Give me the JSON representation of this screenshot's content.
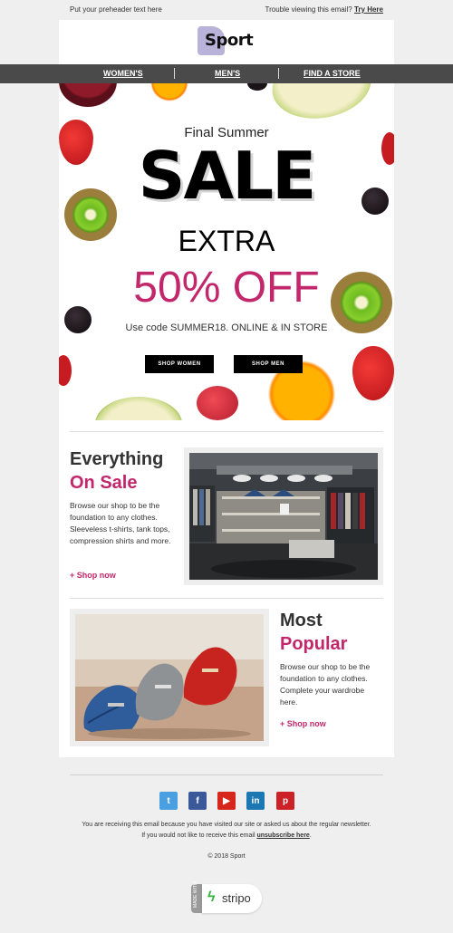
{
  "preheader": {
    "text": "Put your preheader text here",
    "trouble": "Trouble viewing this email?",
    "try_here": "Try Here"
  },
  "logo": {
    "text": "Sport"
  },
  "nav": {
    "items": [
      "WOMEN'S",
      "MEN'S",
      "FIND A STORE"
    ]
  },
  "hero": {
    "line1": "Final Summer",
    "line2": "SALE",
    "line3": "EXTRA",
    "line4": "50% OFF",
    "code": "Use code SUMMER18. ONLINE & IN STORE",
    "btn_women": "SHOP WOMEN",
    "btn_men": "SHOP MEN"
  },
  "section1": {
    "title_dark": "Everything",
    "title_pink": "On Sale",
    "body": "Browse our shop to be the foundation to any clothes. Sleeveless t-shirts, tank tops, compression shirts and more.",
    "link": "+ Shop now"
  },
  "section2": {
    "title_dark": "Most",
    "title_pink": "Popular",
    "body": "Browse our shop to be the foundation to any clothes. Complete your wardrobe here.",
    "link": "+ Shop now"
  },
  "footer": {
    "line1": "You are receiving this email because you have visited our site or asked us about the regular newsletter.",
    "line2_pre": "If you would not like to receive this email",
    "unsubscribe": "unsubscribe here",
    "line2_post": ".",
    "copyright": "© 2018 Sport",
    "badge_text": "stripo",
    "badge_side": "MADE WITH"
  },
  "social": [
    {
      "name": "twitter-icon",
      "glyph": "t",
      "color": "#4a9fe0"
    },
    {
      "name": "facebook-icon",
      "glyph": "f",
      "color": "#3b5998"
    },
    {
      "name": "youtube-icon",
      "glyph": "▶",
      "color": "#d7261c"
    },
    {
      "name": "linkedin-icon",
      "glyph": "in",
      "color": "#1c78b3"
    },
    {
      "name": "pinterest-icon",
      "glyph": "p",
      "color": "#cb2127"
    }
  ],
  "colors": {
    "accent": "#c2266b",
    "nav_bg": "#4a4a4a",
    "page_bg": "#efefef"
  }
}
